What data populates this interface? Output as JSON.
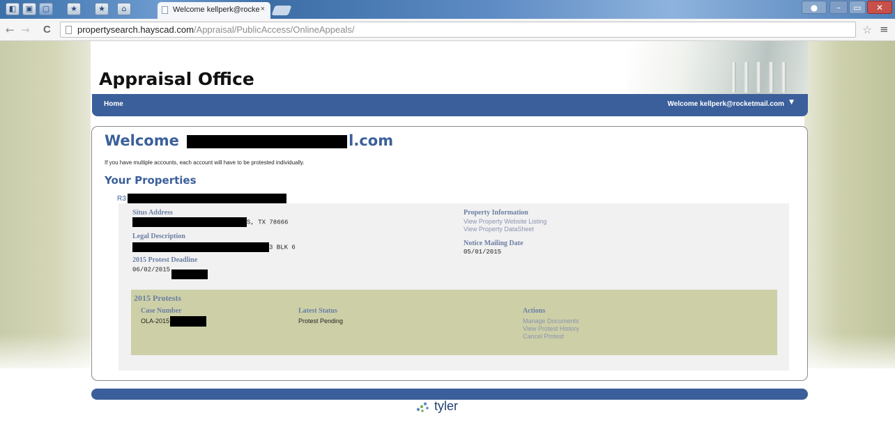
{
  "browser": {
    "tab_title": "Welcome kellperk@rocke",
    "tab_close": "×",
    "url_domain": "propertysearch.hayscad.com",
    "url_path": "/Appraisal/PublicAccess/OnlineAppeals/",
    "back_glyph": "←",
    "forward_glyph": "→",
    "reload_glyph": "C",
    "star_glyph": "☆",
    "menu_glyph": "≡"
  },
  "site": {
    "header_title": "Appraisal Office",
    "nav_home": "Home",
    "nav_welcome": "Welcome kellperk@rocketmail.com",
    "nav_caret": "▼"
  },
  "main": {
    "welcome_prefix": "Welcome",
    "welcome_suffix": "l.com",
    "intro": "If you have multiple accounts, each account will have to be protested individually.",
    "properties_title": "Your Properties",
    "account_prefix": "R3"
  },
  "property": {
    "situs_label": "Situs Address",
    "situs_value": "S, TX 78666",
    "legal_label": "Legal Description",
    "legal_value": "3 BLK 6",
    "deadline_label": "2015 Protest Deadline",
    "deadline_value": "06/02/2015",
    "info_label": "Property Information",
    "link_website": "View Property Website Listing",
    "link_datasheet": "View Property DataSheet",
    "notice_label": "Notice Mailing Date",
    "notice_value": "05/01/2015"
  },
  "protests": {
    "title": "2015 Protests",
    "col_case": "Case Number",
    "col_status": "Latest Status",
    "col_actions": "Actions",
    "case_value": "OLA-2015",
    "status_value": "Protest Pending",
    "action_manage": "Manage Documents",
    "action_history": "View Protest History",
    "action_cancel": "Cancel Protest"
  },
  "footer": {
    "brand": "tyler"
  }
}
